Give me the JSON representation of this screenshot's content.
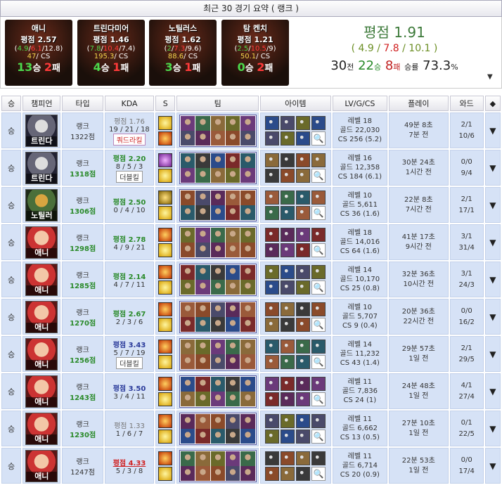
{
  "header": {
    "title": "최근 30 경기 요약 ( 랭크 )"
  },
  "champ_summary": [
    {
      "name": "애니",
      "score": "평점 2.57",
      "k": "4.9",
      "d": "6.1",
      "a": "12.8",
      "cs_n": "47",
      "cs_label": "CS",
      "wins": "13",
      "win_suffix": "승",
      "losses": "2",
      "loss_suffix": "패"
    },
    {
      "name": "트린다미어",
      "score": "평점 1.46",
      "k": "7.8",
      "d": "10.4",
      "a": "7.4",
      "cs_n": "195.3",
      "cs_label": "CS",
      "wins": "4",
      "win_suffix": "승",
      "losses": "1",
      "loss_suffix": "패"
    },
    {
      "name": "노틸러스",
      "score": "평점 1.62",
      "k": "2",
      "d": "7.3",
      "a": "9.6",
      "cs_n": "88.6",
      "cs_label": "CS",
      "wins": "3",
      "win_suffix": "승",
      "losses": "1",
      "loss_suffix": "패"
    },
    {
      "name": "탐 켄치",
      "score": "평점 1.21",
      "k": "2.5",
      "d": "10.5",
      "a": "9",
      "cs_n": "50.1",
      "cs_label": "CS",
      "wins": "0",
      "win_suffix": "승",
      "losses": "2",
      "loss_suffix": "패"
    }
  ],
  "average": {
    "label": "평점 1.91",
    "k": "4.9",
    "d": "7.8",
    "a": "10.1",
    "games": "30",
    "games_suffix": "전",
    "wins": "22",
    "wins_suffix": "승",
    "losses": "8",
    "losses_suffix": "패",
    "rate_label": "승률",
    "rate": "73.3",
    "rate_suffix": "%"
  },
  "columns": [
    "승",
    "챔피언",
    "타입",
    "KDA",
    "S",
    "팀",
    "아이템",
    "LV/G/CS",
    "플레이",
    "와드"
  ],
  "matches": [
    {
      "result": "승",
      "champ": "트린다",
      "cls": "tryn",
      "type": "랭크",
      "pts": "1322점",
      "pts_g": false,
      "score": "평점 1.76",
      "score_cls": "score-gray",
      "kda": "19 / 21 / 18",
      "badge": "쿼드라킬",
      "badge_cls": "",
      "spells": [
        "flash",
        "ignite"
      ],
      "level": "레벨 18",
      "gold": "골드 22,030",
      "cs": "CS 256 (5.2)",
      "dur": "49분 8초",
      "ago": "7분 전",
      "w1": "2/1",
      "w2": "10/6"
    },
    {
      "result": "승",
      "champ": "트린다",
      "cls": "tryn",
      "type": "랭크",
      "pts": "1318점",
      "pts_g": true,
      "score": "평점 2.20",
      "score_cls": "score-g",
      "kda": "8 / 5 / 3",
      "badge": "더블킬",
      "badge_cls": "dbl",
      "spells": [
        "tele",
        "flash"
      ],
      "level": "레벨 16",
      "gold": "골드 12,358",
      "cs": "CS 184 (6.1)",
      "dur": "30분 24초",
      "ago": "1시간 전",
      "w1": "0/0",
      "w2": "9/4"
    },
    {
      "result": "승",
      "champ": "노틸러",
      "cls": "naut",
      "type": "랭크",
      "pts": "1306점",
      "pts_g": true,
      "score": "평점 2.50",
      "score_cls": "score-g",
      "kda": "0 / 4 / 10",
      "badge": "",
      "badge_cls": "",
      "spells": [
        "smite",
        "flash"
      ],
      "level": "레벨 10",
      "gold": "골드 5,611",
      "cs": "CS 36 (1.6)",
      "dur": "22분 8초",
      "ago": "7시간 전",
      "w1": "2/1",
      "w2": "17/1"
    },
    {
      "result": "승",
      "champ": "애니",
      "cls": "ann",
      "type": "랭크",
      "pts": "1298점",
      "pts_g": true,
      "score": "평점 2.78",
      "score_cls": "score-g",
      "kda": "4 / 9 / 21",
      "badge": "",
      "badge_cls": "",
      "spells": [
        "ignite",
        "flash"
      ],
      "level": "레벨 18",
      "gold": "골드 14,016",
      "cs": "CS 64 (1.6)",
      "dur": "41분 17초",
      "ago": "9시간 전",
      "w1": "3/1",
      "w2": "31/4"
    },
    {
      "result": "승",
      "champ": "애니",
      "cls": "ann",
      "type": "랭크",
      "pts": "1285점",
      "pts_g": true,
      "score": "평점 2.14",
      "score_cls": "score-g",
      "kda": "4 / 7 / 11",
      "badge": "",
      "badge_cls": "",
      "spells": [
        "ignite",
        "flash"
      ],
      "level": "레벨 14",
      "gold": "골드 10,170",
      "cs": "CS 25 (0.8)",
      "dur": "32분 36초",
      "ago": "10시간 전",
      "w1": "3/1",
      "w2": "24/3"
    },
    {
      "result": "승",
      "champ": "애니",
      "cls": "ann",
      "type": "랭크",
      "pts": "1270점",
      "pts_g": true,
      "score": "평점 2.67",
      "score_cls": "score-g",
      "kda": "2 / 3 / 6",
      "badge": "",
      "badge_cls": "",
      "spells": [
        "ignite",
        "flash"
      ],
      "level": "레벨 10",
      "gold": "골드 5,707",
      "cs": "CS 9 (0.4)",
      "dur": "20분 36초",
      "ago": "22시간 전",
      "w1": "0/0",
      "w2": "16/2"
    },
    {
      "result": "승",
      "champ": "애니",
      "cls": "ann",
      "type": "랭크",
      "pts": "1256점",
      "pts_g": true,
      "score": "평점 3.43",
      "score_cls": "score-b",
      "kda": "5 / 7 / 19",
      "badge": "더블킬",
      "badge_cls": "dbl",
      "spells": [
        "ignite",
        "flash"
      ],
      "level": "레벨 14",
      "gold": "골드 11,232",
      "cs": "CS 43 (1.4)",
      "dur": "29분 57초",
      "ago": "1일 전",
      "w1": "2/1",
      "w2": "29/5"
    },
    {
      "result": "승",
      "champ": "애니",
      "cls": "ann",
      "type": "랭크",
      "pts": "1243점",
      "pts_g": true,
      "score": "평점 3.50",
      "score_cls": "score-b",
      "kda": "3 / 4 / 11",
      "badge": "",
      "badge_cls": "",
      "spells": [
        "ignite",
        "flash"
      ],
      "level": "레벨 11",
      "gold": "골드 7,836",
      "cs": "CS 24 (1)",
      "dur": "24분 48초",
      "ago": "1일 전",
      "w1": "4/1",
      "w2": "27/4"
    },
    {
      "result": "승",
      "champ": "애니",
      "cls": "ann",
      "type": "랭크",
      "pts": "1230점",
      "pts_g": true,
      "score": "평점 1.33",
      "score_cls": "score-gray",
      "kda": "1 / 6 / 7",
      "badge": "",
      "badge_cls": "",
      "spells": [
        "ignite",
        "flash"
      ],
      "level": "레벨 11",
      "gold": "골드 6,662",
      "cs": "CS 13 (0.5)",
      "dur": "27분 10초",
      "ago": "1일 전",
      "w1": "0/1",
      "w2": "22/5"
    },
    {
      "result": "승",
      "champ": "애니",
      "cls": "ann",
      "type": "랭크",
      "pts": "1247점",
      "pts_g": false,
      "score": "평점 4.33",
      "score_cls": "score-r",
      "kda": "5 / 3 / 8",
      "badge": "",
      "badge_cls": "",
      "spells": [
        "ignite",
        "flash"
      ],
      "level": "레벨 11",
      "gold": "골드 6,714",
      "cs": "CS 20 (0.9)",
      "dur": "22분 53초",
      "ago": "1일 전",
      "w1": "0/0",
      "w2": "17/4"
    }
  ]
}
